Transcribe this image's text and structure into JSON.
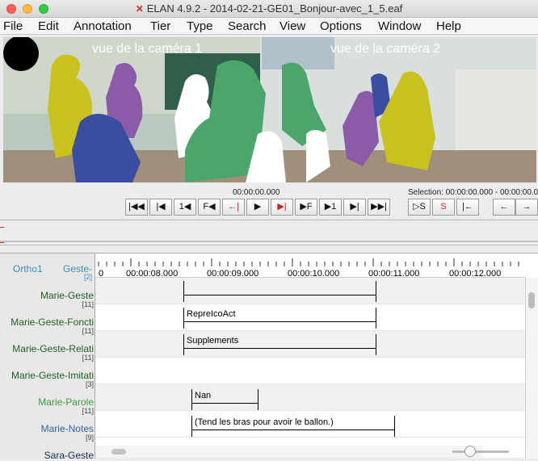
{
  "window": {
    "title": "ELAN 4.9.2 - 2014-02-21-GE01_Bonjour-avec_1_5.eaf",
    "app_icon": "elan-icon"
  },
  "menu": [
    "File",
    "Edit",
    "Annotation",
    "Tier",
    "Type",
    "Search",
    "View",
    "Options",
    "Window",
    "Help"
  ],
  "video": {
    "camera1_label": "vue de la caméra 1",
    "camera2_label": "vue de la caméra 2"
  },
  "media": {
    "current_time": "00:00:00.000",
    "selection": "Selection: 00:00:00.000 - 00:00:00.000"
  },
  "player_buttons": [
    {
      "name": "go-to-begin-button",
      "glyph": "|◀◀"
    },
    {
      "name": "previous-frame-step-button",
      "glyph": "|◀"
    },
    {
      "name": "pixel-step-back-button",
      "glyph": "1◀"
    },
    {
      "name": "frame-back-button",
      "glyph": "F◀"
    },
    {
      "name": "previous-scroll-view-button",
      "glyph": "←|"
    },
    {
      "name": "play-button",
      "glyph": "▶"
    },
    {
      "name": "play-selection-button",
      "glyph": "▶|"
    },
    {
      "name": "frame-forward-button",
      "glyph": "▶F"
    },
    {
      "name": "pixel-step-forward-button",
      "glyph": "▶1"
    },
    {
      "name": "next-frame-step-button",
      "glyph": "▶|"
    },
    {
      "name": "go-to-end-button",
      "glyph": "▶▶|"
    }
  ],
  "selection_buttons": [
    {
      "name": "play-selection-s-button",
      "glyph": "▷S"
    },
    {
      "name": "clear-selection-button",
      "glyph": "S"
    },
    {
      "name": "selection-mode-button",
      "glyph": "|←"
    }
  ],
  "nav_buttons": [
    {
      "name": "arrow-left-button",
      "glyph": "←"
    },
    {
      "name": "arrow-right-button",
      "glyph": "→"
    }
  ],
  "timeline": {
    "header_left": "Ortho1",
    "header_right": "Geste-",
    "header_count": "[2]",
    "ticks": [
      "0",
      "00:00:08.000",
      "00:00:09.000",
      "00:00:10.000",
      "00:00:11.000",
      "00:00:12.000"
    ]
  },
  "tiers": [
    {
      "label": "Marie-Geste",
      "count": "[11]",
      "color": "#1f5f1f"
    },
    {
      "label": "Marie-Geste-Foncti",
      "count": "[11]",
      "color": "#1f5f1f"
    },
    {
      "label": "Marie-Geste-Relati",
      "count": "[11]",
      "color": "#1f5f1f"
    },
    {
      "label": "Marie-Geste-Imitati",
      "count": "[3]",
      "color": "#1f5f1f"
    },
    {
      "label": "Marie-Parole",
      "count": "[11]",
      "color": "#3c9a3c"
    },
    {
      "label": "Marie-Notes",
      "count": "[9]",
      "color": "#2b64a8"
    },
    {
      "label": "Sara-Geste",
      "count": "",
      "color": "#1b2f5c"
    }
  ],
  "annotations": {
    "geste": "",
    "foncti": "RepreIcoAct",
    "relati": "Supplements",
    "parole": "Nan",
    "notes": "(Tend les bras pour avoir le ballon.)"
  }
}
